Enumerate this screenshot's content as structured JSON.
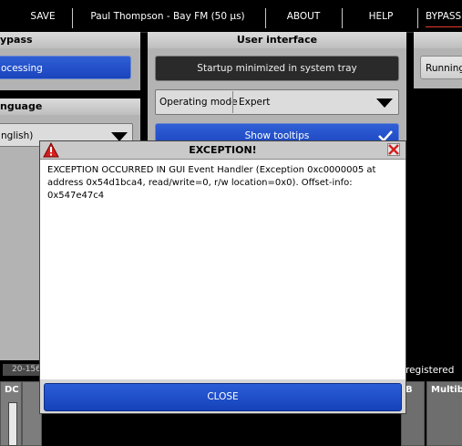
{
  "menubar": {
    "save_label": "SAVE",
    "station_label": "Paul Thompson - Bay FM (50 µs)",
    "about_label": "ABOUT",
    "help_label": "HELP",
    "bypass_label": "BYPASS"
  },
  "bypass_panel": {
    "title": "ypass",
    "processing_label": "ocessing"
  },
  "language_panel": {
    "title": "nguage",
    "value": "nglish)"
  },
  "ui_panel": {
    "title": "User interface",
    "startup_label": "Startup minimized in system tray",
    "operating_mode_label": "Operating mode",
    "operating_mode_value": "Expert",
    "tooltips_label": "Show tooltips"
  },
  "right_panel": {
    "running_label": "Running"
  },
  "status": {
    "left_text": "20-156",
    "right_text": "registered"
  },
  "bottom_tabs": {
    "dc_label": "DC",
    "b_label": "B",
    "multiband_label": "Multib"
  },
  "dialog": {
    "title": "EXCEPTION!",
    "message": "EXCEPTION OCCURRED IN GUI Event Handler (Exception 0xc0000005 at\naddress 0x54d1bca4, read/write=0, r/w location=0x0). Offset-info: 0x547e47c4",
    "close_label": "CLOSE"
  },
  "colors": {
    "accent_blue": "#1a44bd",
    "bypass_underline": "#e23a2a",
    "warning_red": "#d42020"
  }
}
